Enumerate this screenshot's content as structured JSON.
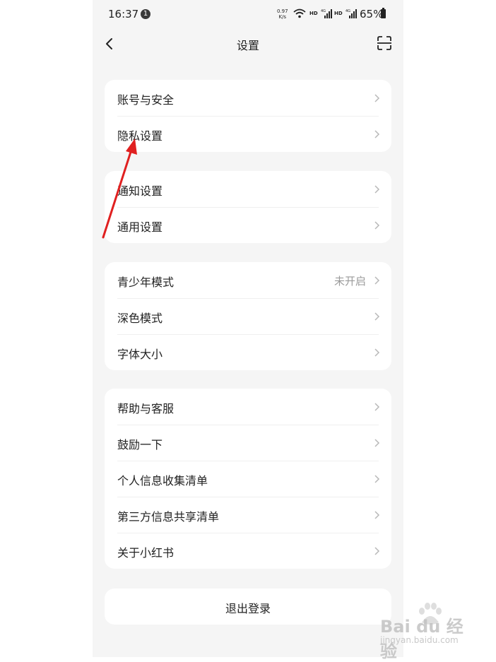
{
  "status_bar": {
    "time": "16:37",
    "notification_count": "1",
    "net_speed_value": "0.97",
    "net_speed_unit": "K/s",
    "hd_label": "HD",
    "network_label": "4G",
    "battery": "65%"
  },
  "nav": {
    "title": "设置",
    "back_icon": "chevron-left-icon",
    "scan_icon": "scan-icon"
  },
  "groups": [
    {
      "items": [
        {
          "label": "账号与安全",
          "value": ""
        },
        {
          "label": "隐私设置",
          "value": ""
        }
      ]
    },
    {
      "items": [
        {
          "label": "通知设置",
          "value": ""
        },
        {
          "label": "通用设置",
          "value": ""
        }
      ]
    },
    {
      "items": [
        {
          "label": "青少年模式",
          "value": "未开启"
        },
        {
          "label": "深色模式",
          "value": ""
        },
        {
          "label": "字体大小",
          "value": ""
        }
      ]
    },
    {
      "items": [
        {
          "label": "帮助与客服",
          "value": ""
        },
        {
          "label": "鼓励一下",
          "value": ""
        },
        {
          "label": "个人信息收集清单",
          "value": ""
        },
        {
          "label": "第三方信息共享清单",
          "value": ""
        },
        {
          "label": "关于小红书",
          "value": ""
        }
      ]
    }
  ],
  "logout": {
    "label": "退出登录"
  },
  "watermark": {
    "brand": "Bai du 经验",
    "url": "jingyan.baidu.com"
  },
  "colors": {
    "annotation_arrow": "#e02020",
    "background": "#f5f5f5",
    "card": "#ffffff"
  }
}
